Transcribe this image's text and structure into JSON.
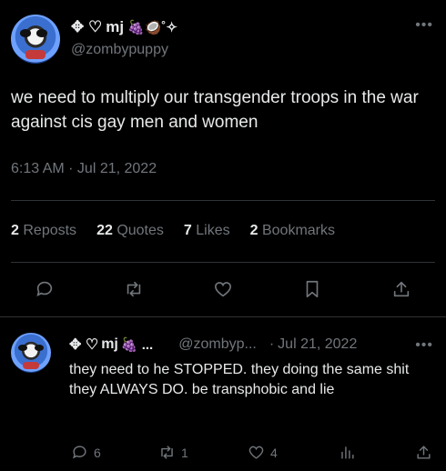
{
  "tweet": {
    "display_name_prefix": "✥ ♡",
    "display_name": "mj",
    "display_name_suffix": "🍇🥥˚✧",
    "handle": "@zombypuppy",
    "text": "we need to multiply our transgender troops in the war against cis gay men and women",
    "timestamp": "6:13 AM · Jul 21, 2022",
    "stats": {
      "reposts_count": "2",
      "reposts_label": "Reposts",
      "quotes_count": "22",
      "quotes_label": "Quotes",
      "likes_count": "7",
      "likes_label": "Likes",
      "bookmarks_count": "2",
      "bookmarks_label": "Bookmarks"
    },
    "actions": [
      "reply-icon",
      "repost-icon",
      "like-icon",
      "bookmark-icon",
      "share-icon"
    ]
  },
  "reply": {
    "display_name_prefix": "✥ ♡",
    "display_name": "mj",
    "display_name_suffix": "🍇 ...",
    "handle": "@zombyp...",
    "date": "Jul 21, 2022",
    "text": "they need to he STOPPED. they doing the same shit they ALWAYS DO. be transphobic and lie",
    "reply_count": "6",
    "repost_count": "1",
    "like_count": "4",
    "actions": [
      "reply-icon",
      "repost-icon",
      "like-icon",
      "views-icon",
      "share-icon"
    ]
  },
  "colors": {
    "background": "#000000",
    "text": "#e7e9ea",
    "muted": "#71767b",
    "divider": "#2f3336"
  }
}
